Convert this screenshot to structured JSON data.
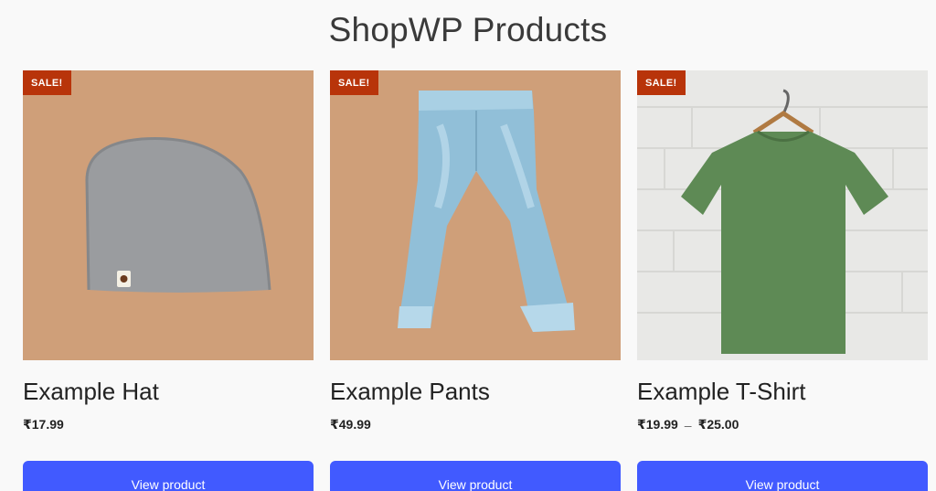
{
  "page": {
    "title": "ShopWP Products"
  },
  "products": [
    {
      "name": "Example Hat",
      "badge": "SALE!",
      "price": "₹17.99",
      "button": "View product",
      "image_icon": "hat-photo"
    },
    {
      "name": "Example Pants",
      "badge": "SALE!",
      "price": "₹49.99",
      "button": "View product",
      "image_icon": "pants-photo"
    },
    {
      "name": "Example T-Shirt",
      "badge": "SALE!",
      "price_min": "₹19.99",
      "price_sep": "–",
      "price_max": "₹25.00",
      "button": "View product",
      "image_icon": "tshirt-photo"
    }
  ],
  "colors": {
    "badge": "#b8340a",
    "button": "#415aff",
    "tan_background": "#cf9f79"
  }
}
